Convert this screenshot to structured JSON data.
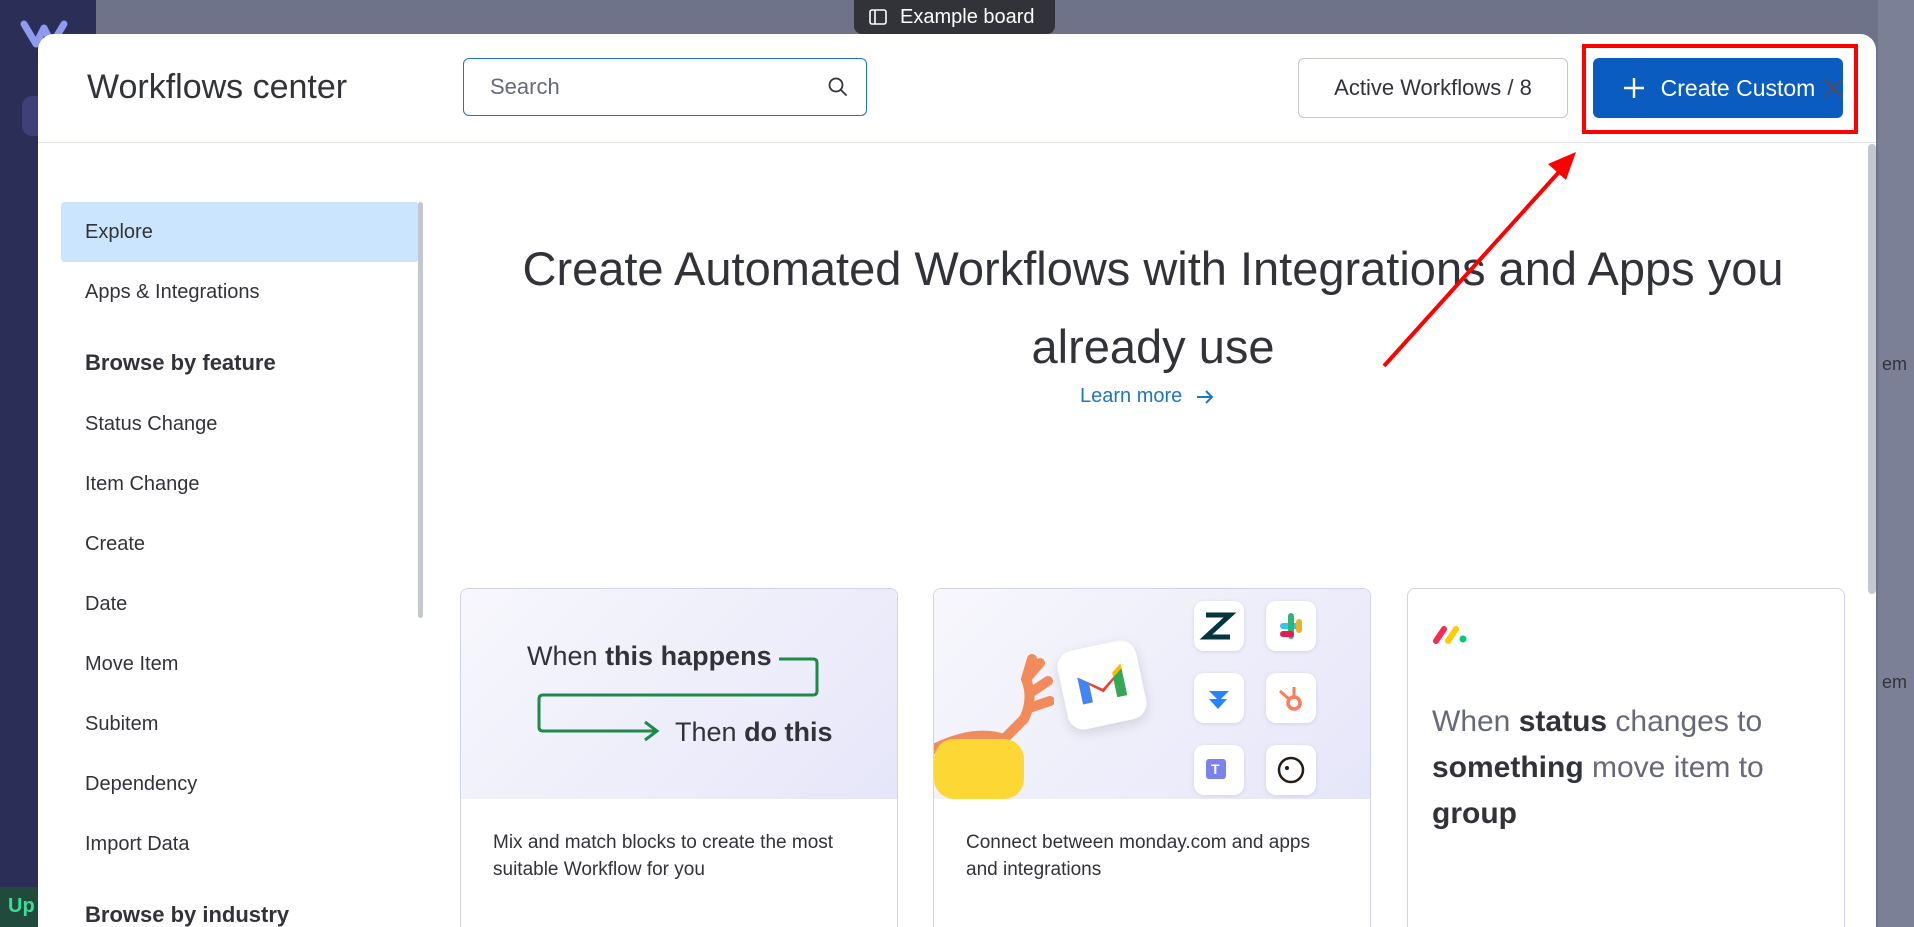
{
  "board_tab": {
    "label": "Example board"
  },
  "background": {
    "upgrade_label": "Up",
    "right_fragments": [
      "em",
      "em"
    ]
  },
  "modal": {
    "title": "Workflows center",
    "search": {
      "placeholder": "Search",
      "value": ""
    },
    "active_workflows_label": "Active Workflows / 8",
    "create_custom_label": "Create Custom"
  },
  "sidebar": {
    "items_top": [
      {
        "label": "Explore",
        "active": true
      },
      {
        "label": "Apps & Integrations",
        "active": false
      }
    ],
    "section_feature": "Browse by feature",
    "feature_items": [
      "Status Change",
      "Item Change",
      "Create",
      "Date",
      "Move Item",
      "Subitem",
      "Dependency",
      "Import Data"
    ],
    "section_industry": "Browse by industry"
  },
  "hero": {
    "title_line1": "Create Automated Workflows with Integrations and Apps you",
    "title_line2": "already use",
    "learn_more": "Learn more"
  },
  "cards": [
    {
      "diagram": {
        "when": "When",
        "when_bold": "this happens",
        "then": "Then",
        "then_bold": "do this"
      },
      "text": "Mix and match blocks to create the most suitable Workflow for you"
    },
    {
      "text": "Connect between monday.com and apps and integrations",
      "icons": [
        "zendesk-icon",
        "slack-icon",
        "jira-icon",
        "hubspot-icon",
        "teams-icon",
        "mailchimp-icon",
        "gmail-icon"
      ]
    },
    {
      "icon": "monday-logo-icon",
      "parts": [
        {
          "t": "When ",
          "b": false
        },
        {
          "t": "status",
          "b": true
        },
        {
          "t": " changes to ",
          "b": false
        },
        {
          "t": "something",
          "b": true
        },
        {
          "t": " move item to ",
          "b": false
        },
        {
          "t": "group",
          "b": true
        }
      ]
    }
  ],
  "colors": {
    "primary": "#0b5cc1",
    "accent_link": "#1f76c2",
    "annotation": "#ff0000",
    "sidebar_active": "#cce5ff"
  }
}
